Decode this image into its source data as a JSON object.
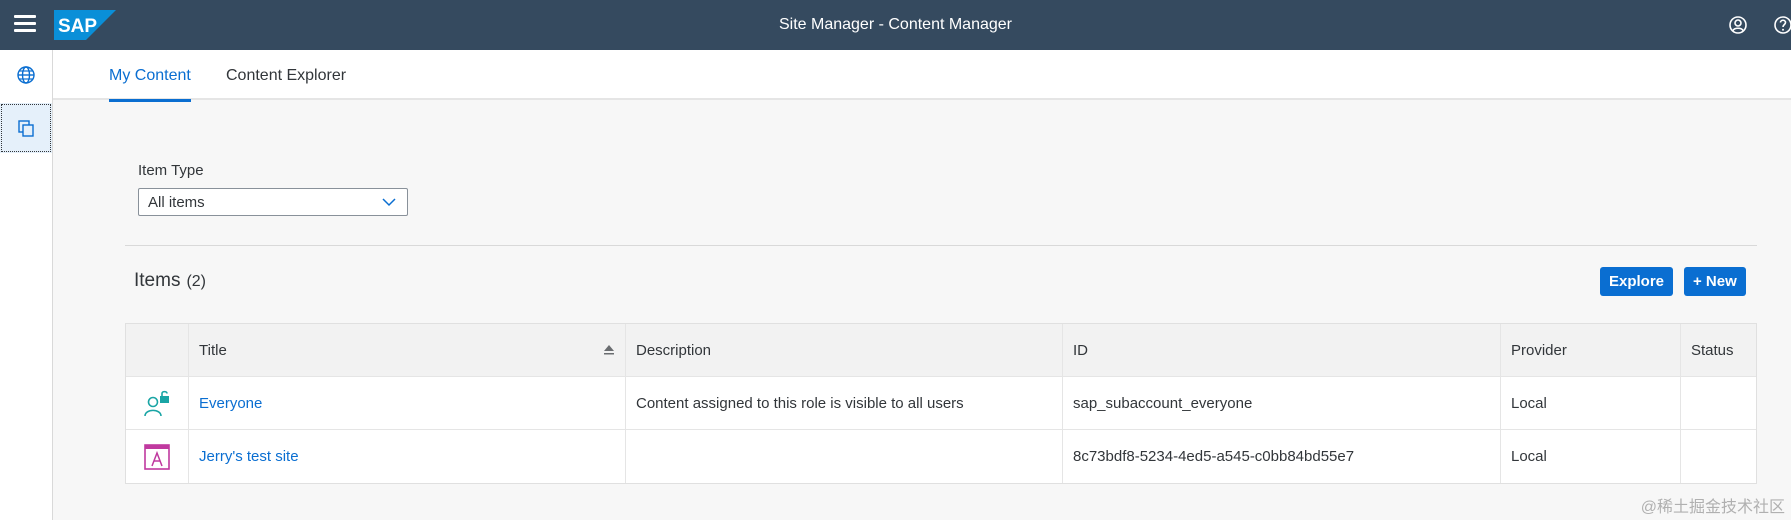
{
  "shell": {
    "title": "Site Manager - Content Manager",
    "logo_text": "SAP",
    "icons": [
      "menu-icon",
      "user-icon",
      "help-icon"
    ]
  },
  "sidenav": {
    "items": [
      {
        "icon": "globe-icon"
      },
      {
        "icon": "content-copy-icon",
        "selected": true
      }
    ]
  },
  "tabs": [
    {
      "label": "My Content",
      "active": true
    },
    {
      "label": "Content Explorer",
      "active": false
    }
  ],
  "filter": {
    "label": "Item Type",
    "value": "All items"
  },
  "items": {
    "title": "Items",
    "count": "(2)",
    "explore_label": "Explore",
    "new_label": "+ New"
  },
  "table": {
    "columns": [
      "Title",
      "Description",
      "ID",
      "Provider",
      "Status"
    ],
    "rows": [
      {
        "icon": "role-icon",
        "title": "Everyone",
        "description": "Content assigned to this role is visible to all users",
        "id": "sap_subaccount_everyone",
        "provider": "Local",
        "status": ""
      },
      {
        "icon": "site-icon",
        "title": "Jerry's test site",
        "description": "",
        "id": "8c73bdf8-5234-4ed5-a545-c0bb84bd55e7",
        "provider": "Local",
        "status": ""
      }
    ]
  },
  "watermark": "@稀土掘金技术社区",
  "colors": {
    "shell": "#354a5f",
    "accent": "#0a6ed1",
    "role_icon": "#1aa5a5",
    "site_icon": "#c0399f"
  }
}
